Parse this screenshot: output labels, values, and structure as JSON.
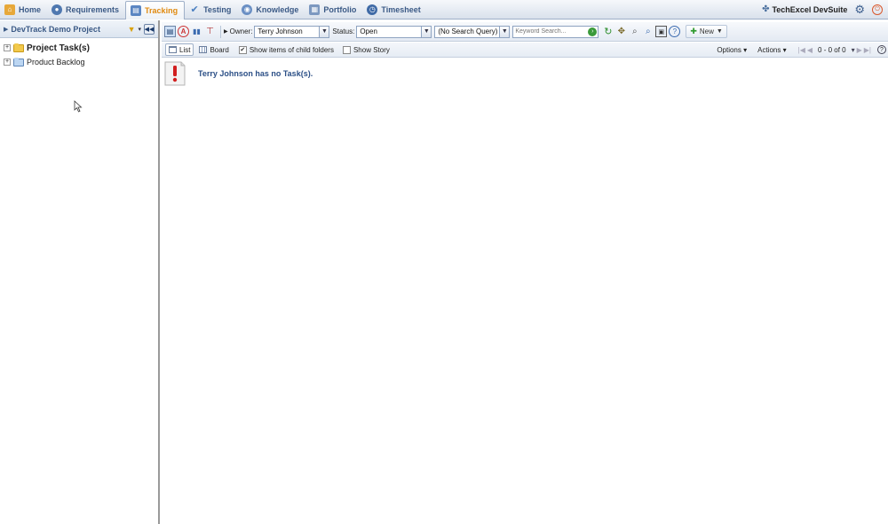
{
  "nav": {
    "items": [
      {
        "label": "Home",
        "icon": "home-icon",
        "active": false
      },
      {
        "label": "Requirements",
        "icon": "requirements-icon",
        "active": false
      },
      {
        "label": "Tracking",
        "icon": "tracking-icon",
        "active": true
      },
      {
        "label": "Testing",
        "icon": "testing-icon",
        "active": false
      },
      {
        "label": "Knowledge",
        "icon": "knowledge-icon",
        "active": false
      },
      {
        "label": "Portfolio",
        "icon": "portfolio-icon",
        "active": false
      },
      {
        "label": "Timesheet",
        "icon": "timesheet-icon",
        "active": false
      }
    ],
    "brand": "TechExcel DevSuite",
    "colors": {
      "active_tab_text": "#e08a10",
      "tab_text": "#3b5a86"
    }
  },
  "left_panel": {
    "project_title": "DevTrack Demo Project",
    "tree": [
      {
        "label": "Project Task(s)",
        "bold": true,
        "folder": "yellow"
      },
      {
        "label": "Product Backlog",
        "bold": false,
        "folder": "blue"
      }
    ]
  },
  "toolbar": {
    "owner_label": "Owner:",
    "owner_value": "Terry Johnson",
    "status_label": "Status:",
    "status_value": "Open",
    "query_value": "(No Search Query)",
    "search_placeholder": "Keyword Search...",
    "new_label": "New"
  },
  "subtoolbar": {
    "list_label": "List",
    "board_label": "Board",
    "show_child_label": "Show items of child folders",
    "show_child_checked": true,
    "show_story_label": "Show Story",
    "show_story_checked": false,
    "options_label": "Options",
    "actions_label": "Actions",
    "pager_text": "0 - 0 of 0"
  },
  "content": {
    "message": "Terry Johnson has no Task(s)."
  }
}
